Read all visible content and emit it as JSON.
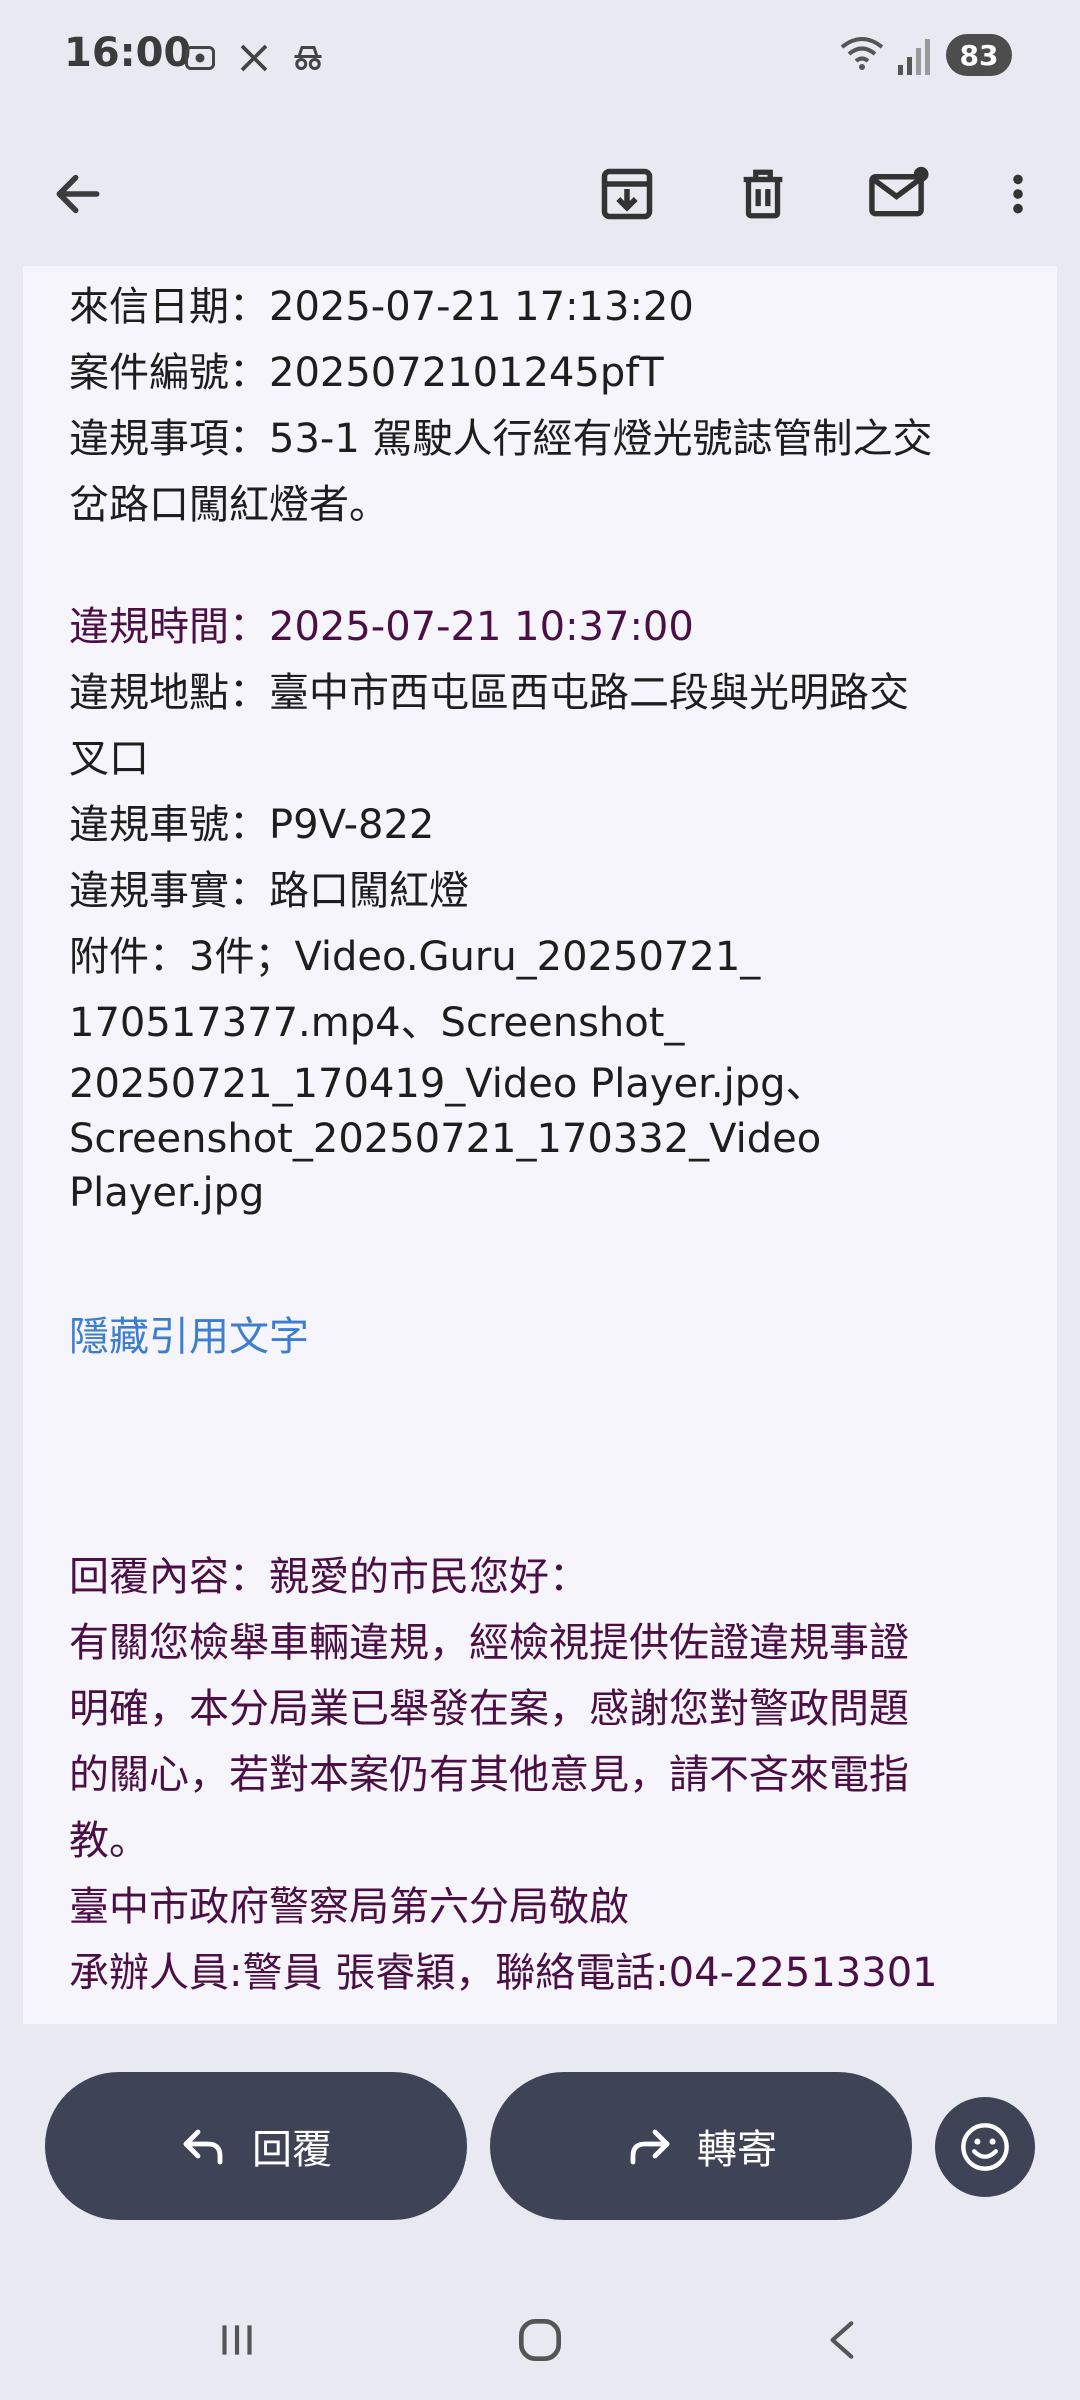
{
  "status_bar": {
    "time": "16:00",
    "battery": "83"
  },
  "email": {
    "lines": [
      "來信日期：2025-07-21 17:13:20",
      "案件編號：2025072101245pfT",
      "違規事項：53-1 駕駛人行經有燈光號誌管制之交",
      "岔路口闖紅燈者。"
    ],
    "violation_time": "違規時間：2025-07-21 10:37:00",
    "details": [
      "違規地點：臺中市西屯區西屯路二段與光明路交",
      "叉口",
      "違規車號：P9V-822",
      "違規事實：路口闖紅燈",
      "附件：3件；Video.Guru_20250721_",
      "170517377.mp4、Screenshot_",
      "20250721_170419_Video Player.jpg、",
      "Screenshot_20250721_170332_Video",
      "Player.jpg"
    ],
    "hide_quoted": "隱藏引用文字",
    "reply": [
      "回覆內容：親愛的市民您好：",
      "有關您檢舉車輛違規，經檢視提供佐證違規事證",
      "明確，本分局業已舉發在案，感謝您對警政問題",
      "的關心，若對本案仍有其他意見，請不吝來電指",
      "教。",
      "臺中市政府警察局第六分局敬啟",
      "承辦人員:警員 張睿穎，聯絡電話:04-22513301"
    ]
  },
  "actions": {
    "reply_label": "回覆",
    "forward_label": "轉寄"
  },
  "icons": {
    "back": "arrow-back-icon",
    "archive": "archive-icon",
    "delete": "trash-icon",
    "mark_unread": "mail-unread-icon",
    "more": "more-vertical-icon",
    "emoji": "emoji-icon"
  },
  "colors": {
    "pill": "#3e4356",
    "link": "#3e7ecf",
    "quote": "#4b0f45"
  }
}
